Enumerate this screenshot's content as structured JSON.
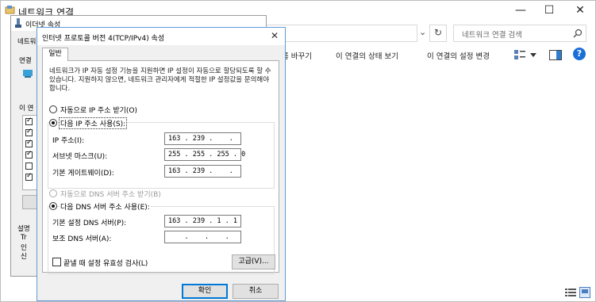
{
  "main_window": {
    "title": "네트워크 연결",
    "minimize": "—",
    "maximize": "☐",
    "close": "✕",
    "refresh": "↻",
    "dropdown": "⌄",
    "search_placeholder": "네트워크 연결 검색",
    "toolbar": {
      "rename": "름 바꾸기",
      "view_status": "이 연결의 상태 보기",
      "change_settings": "이 연결의 설정 변경",
      "help": "?"
    }
  },
  "properties_window": {
    "title": "이더넷 속성",
    "tab_partial": "네트워크",
    "connect_using_partial": "연결",
    "items_partial": "이 연",
    "description_partial": "설명",
    "desc_lines": [
      "Tr",
      "인",
      "신"
    ]
  },
  "ipv4_dialog": {
    "title": "인터넷 프로토콜 버전 4(TCP/IPv4) 속성",
    "close": "✕",
    "tab": "일반",
    "description": "네트워크가 IP 자동 설정 기능을 지원하면 IP 설정이 자동으로 할당되도록 할 수 있습니다. 지원하지 않으면, 네트워크 관리자에게 적절한 IP 설정값을 문의해야 합니다.",
    "ip_auto": "자동으로 IP 주소 받기(O)",
    "ip_manual": "다음 IP 주소 사용(S):",
    "ip_label": "IP 주소(I):",
    "ip_value": "163 . 239 .    .",
    "mask_label": "서브넷 마스크(U):",
    "mask_value": "255 . 255 . 255 . 0",
    "gateway_label": "기본 게이트웨이(D):",
    "gateway_value": "163 . 239 .    .",
    "dns_auto": "자동으로 DNS 서버 주소 받기(B)",
    "dns_manual": "다음 DNS 서버 주소 사용(E):",
    "dns_pref_label": "기본 설정 DNS 서버(P):",
    "dns_pref_value": "163 . 239 . 1 . 1",
    "dns_alt_label": "보조 DNS 서버(A):",
    "dns_alt_value": "    .    .    .",
    "validate": "끝낼 때 설정 유효성 검사(L)",
    "advanced": "고급(V)...",
    "ok": "확인",
    "cancel": "취소"
  },
  "colors": {
    "accent": "#0078d7",
    "help_blue": "#1a6ed8"
  }
}
